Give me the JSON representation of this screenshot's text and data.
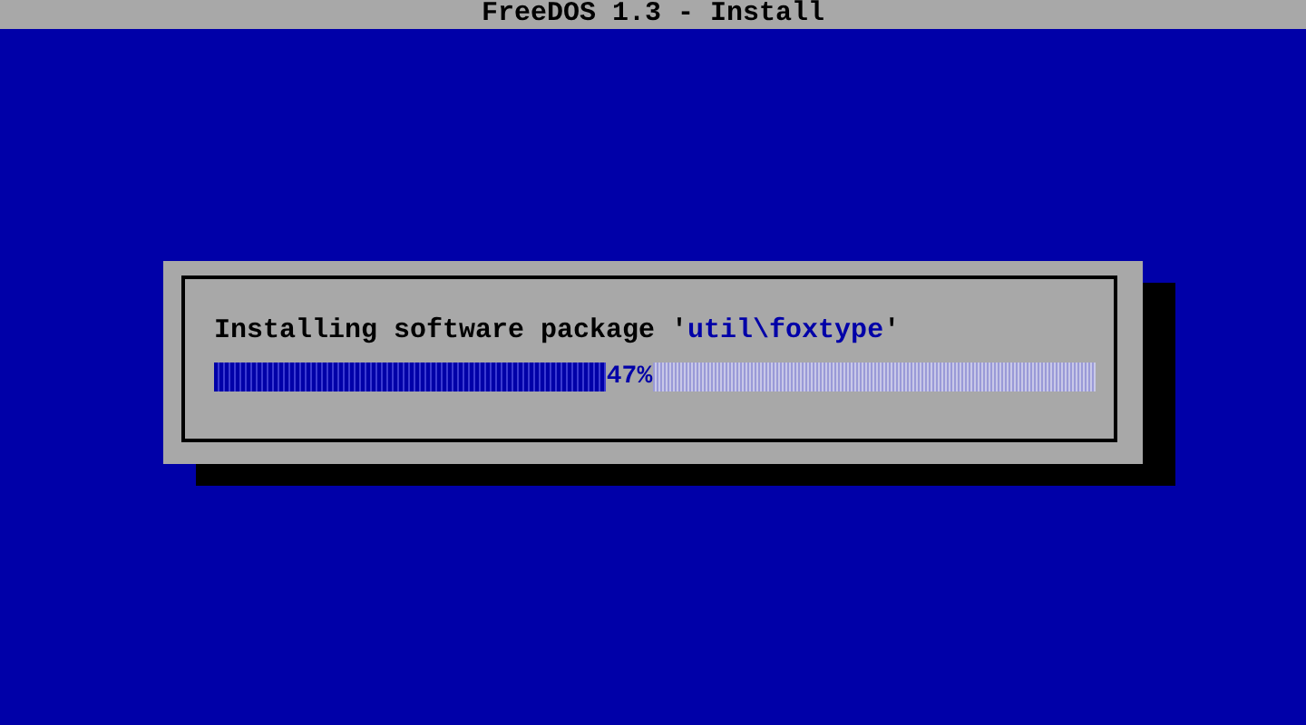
{
  "window": {
    "title": "FreeDOS 1.3 - Install"
  },
  "dialog": {
    "message": {
      "prefix": "Installing software package '",
      "package": "util\\foxtype",
      "suffix": "'"
    },
    "progress": {
      "level": 0.47,
      "reading": "47%"
    }
  }
}
